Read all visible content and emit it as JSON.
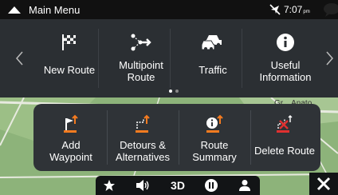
{
  "statusbar": {
    "title": "Main Menu",
    "time": "7:07",
    "ampm": "pm",
    "icons": [
      "menu-chevron-up-icon",
      "gps-off-icon",
      "message-bubble-icon"
    ]
  },
  "tiles": [
    {
      "label": "New Route",
      "icon": "checkered-flag-icon"
    },
    {
      "label": "Multipoint Route",
      "icon": "multipoint-route-icon"
    },
    {
      "label": "Traffic",
      "icon": "traffic-cars-icon"
    },
    {
      "label": "Useful Information",
      "icon": "info-icon"
    }
  ],
  "tile_labels": {
    "multipoint_1": "Multipoint",
    "multipoint_2": "Route",
    "useful_1": "Useful",
    "useful_2": "Information"
  },
  "pager": {
    "pages": 2,
    "current": 1
  },
  "popup": {
    "items": [
      {
        "line1": "Add",
        "line2": "Waypoint",
        "icon": "add-waypoint-icon"
      },
      {
        "line1": "Detours &",
        "line2": "Alternatives",
        "icon": "detour-icon"
      },
      {
        "line1": "Route",
        "line2": "Summary",
        "icon": "route-summary-icon"
      },
      {
        "line1": "Delete Route",
        "line2": "",
        "icon": "delete-route-icon"
      }
    ]
  },
  "map": {
    "partial_label": "Gr... Anato"
  },
  "toolbar": {
    "three_d": "3D",
    "icons": [
      "star-icon",
      "volume-icon",
      "pause-icon",
      "user-icon"
    ]
  },
  "colors": {
    "accent": "#f47b20",
    "tile_bg": "#2b2f33",
    "map_green": "#8fb07a",
    "delete_red": "#e03030"
  }
}
